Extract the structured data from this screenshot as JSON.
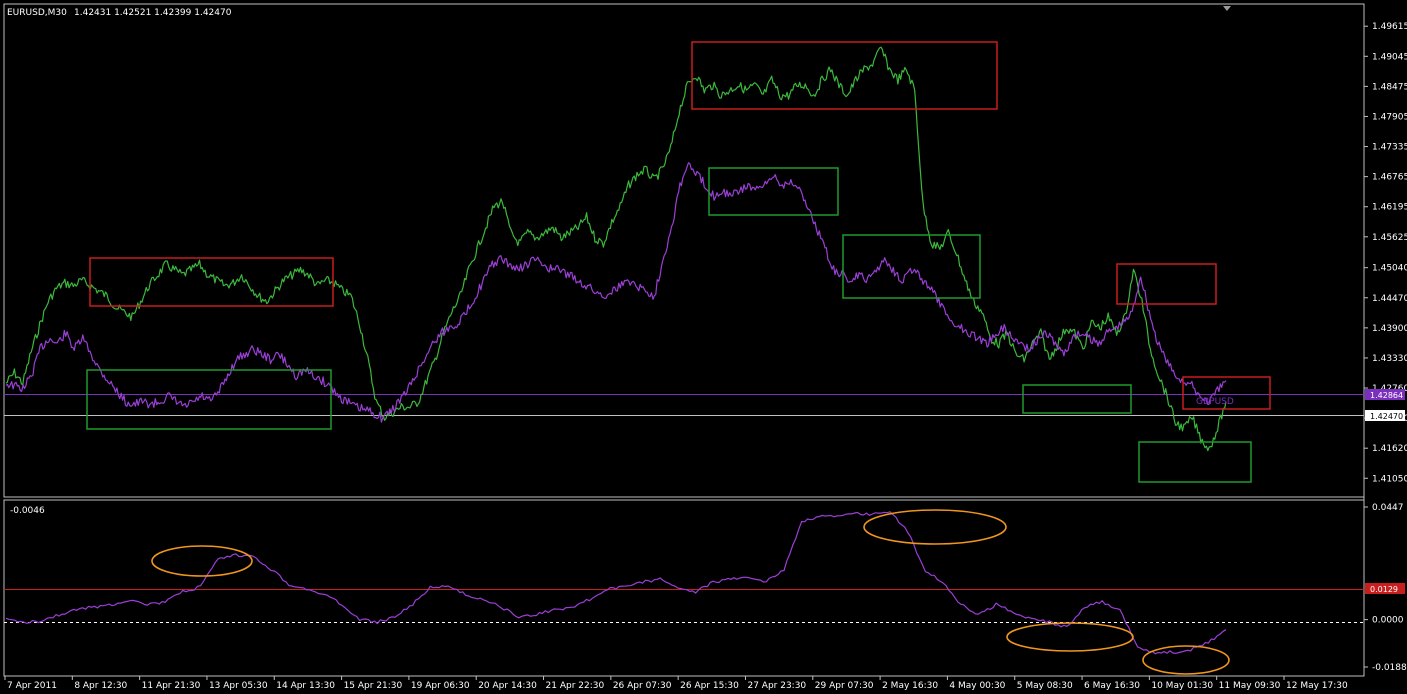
{
  "header": {
    "symbol_timeframe": "EURUSD,M30",
    "ohlc": "1.42431 1.42521 1.42399 1.42470"
  },
  "main_pane": {
    "price_ticks": [
      "1.49615",
      "1.49045",
      "1.48475",
      "1.47905",
      "1.47335",
      "1.46765",
      "1.46195",
      "1.45625",
      "1.45040",
      "1.44470",
      "1.43900",
      "1.43330",
      "1.42760",
      "1.42190",
      "1.41620",
      "1.41050"
    ],
    "price_range": [
      1.4079,
      1.4996
    ],
    "current_price": "1.42470",
    "overlay_price": "1.42864",
    "overlay_label": "GBPUSD",
    "colors": {
      "eurusd": "#3cb93c",
      "gbpusd": "#9b3fd6",
      "red_box": "#c81e1e",
      "green_box": "#1f9a2a",
      "hline": "#7b2fbf",
      "current_line": "#c0c0c0"
    }
  },
  "sub_pane": {
    "top_left_value": "-0.0046",
    "ticks": [
      "0.0447",
      "0.0000",
      "-0.0188"
    ],
    "level_tag": "0.0129",
    "range": [
      -0.0188,
      0.0447
    ],
    "colors": {
      "spread": "#9b3fd6",
      "level": "#c81e1e",
      "ellipse": "#f0961e"
    }
  },
  "time_axis": {
    "labels": [
      "7 Apr 2011",
      "8 Apr 12:30",
      "11 Apr 21:30",
      "13 Apr 05:30",
      "14 Apr 13:30",
      "15 Apr 21:30",
      "19 Apr 06:30",
      "20 Apr 14:30",
      "21 Apr 22:30",
      "26 Apr 07:30",
      "26 Apr 15:30",
      "27 Apr 23:30",
      "29 Apr 07:30",
      "2 May 16:30",
      "4 May 00:30",
      "5 May 08:30",
      "6 May 16:30",
      "10 May 01:30",
      "11 May 09:30",
      "12 May 17:30"
    ]
  },
  "chart_data": [
    {
      "type": "line",
      "title": "EURUSD,M30",
      "ylim": [
        1.4079,
        1.4996
      ],
      "series": [
        {
          "name": "EURUSD",
          "color": "#3cb93c",
          "values": [
            1.4285,
            1.4305,
            1.4285,
            1.4345,
            1.4395,
            1.444,
            1.4465,
            1.4475,
            1.447,
            1.448,
            1.447,
            1.446,
            1.445,
            1.443,
            1.442,
            1.441,
            1.444,
            1.447,
            1.449,
            1.451,
            1.45,
            1.449,
            1.45,
            1.451,
            1.449,
            1.448,
            1.447,
            1.4475,
            1.449,
            1.447,
            1.445,
            1.444,
            1.446,
            1.448,
            1.449,
            1.45,
            1.449,
            1.447,
            1.448,
            1.4475,
            1.446,
            1.445,
            1.44,
            1.433,
            1.425,
            1.422,
            1.423,
            1.424,
            1.424,
            1.425,
            1.429,
            1.433,
            1.438,
            1.442,
            1.445,
            1.45,
            1.454,
            1.458,
            1.462,
            1.463,
            1.457,
            1.455,
            1.457,
            1.456,
            1.457,
            1.458,
            1.456,
            1.457,
            1.458,
            1.46,
            1.456,
            1.455,
            1.459,
            1.462,
            1.466,
            1.468,
            1.469,
            1.467,
            1.469,
            1.473,
            1.48,
            1.485,
            1.487,
            1.484,
            1.485,
            1.483,
            1.484,
            1.485,
            1.484,
            1.485,
            1.483,
            1.486,
            1.483,
            1.483,
            1.485,
            1.485,
            1.483,
            1.486,
            1.488,
            1.485,
            1.483,
            1.486,
            1.488,
            1.489,
            1.492,
            1.488,
            1.486,
            1.488,
            1.484,
            1.462,
            1.455,
            1.454,
            1.457,
            1.453,
            1.448,
            1.444,
            1.442,
            1.437,
            1.436,
            1.438,
            1.434,
            1.433,
            1.436,
            1.438,
            1.433,
            1.436,
            1.439,
            1.438,
            1.435,
            1.44,
            1.439,
            1.441,
            1.438,
            1.441,
            1.45,
            1.444,
            1.435,
            1.43,
            1.426,
            1.421,
            1.42,
            1.422,
            1.418,
            1.416,
            1.42,
            1.425
          ]
        },
        {
          "name": "GBPUSD",
          "color": "#9b3fd6",
          "values": [
            1.4285,
            1.428,
            1.4275,
            1.43,
            1.435,
            1.437,
            1.436,
            1.438,
            1.435,
            1.437,
            1.434,
            1.431,
            1.429,
            1.427,
            1.425,
            1.4245,
            1.425,
            1.4245,
            1.425,
            1.426,
            1.425,
            1.424,
            1.425,
            1.426,
            1.425,
            1.427,
            1.43,
            1.433,
            1.434,
            1.435,
            1.434,
            1.433,
            1.434,
            1.432,
            1.43,
            1.431,
            1.43,
            1.429,
            1.428,
            1.426,
            1.425,
            1.424,
            1.4235,
            1.423,
            1.422,
            1.423,
            1.425,
            1.427,
            1.43,
            1.433,
            1.436,
            1.438,
            1.439,
            1.44,
            1.442,
            1.445,
            1.448,
            1.451,
            1.452,
            1.451,
            1.45,
            1.451,
            1.452,
            1.451,
            1.45,
            1.45,
            1.449,
            1.448,
            1.447,
            1.446,
            1.445,
            1.446,
            1.447,
            1.448,
            1.447,
            1.446,
            1.445,
            1.452,
            1.458,
            1.466,
            1.47,
            1.468,
            1.466,
            1.464,
            1.465,
            1.464,
            1.465,
            1.466,
            1.465,
            1.466,
            1.468,
            1.466,
            1.467,
            1.465,
            1.462,
            1.458,
            1.454,
            1.45,
            1.449,
            1.448,
            1.449,
            1.448,
            1.45,
            1.452,
            1.45,
            1.448,
            1.45,
            1.449,
            1.447,
            1.445,
            1.442,
            1.44,
            1.439,
            1.438,
            1.437,
            1.436,
            1.438,
            1.439,
            1.437,
            1.436,
            1.435,
            1.437,
            1.438,
            1.436,
            1.434,
            1.437,
            1.438,
            1.437,
            1.436,
            1.438,
            1.439,
            1.44,
            1.442,
            1.449,
            1.442,
            1.436,
            1.433,
            1.43,
            1.429,
            1.428,
            1.426,
            1.425,
            1.427,
            1.429
          ]
        }
      ]
    },
    {
      "type": "line",
      "ylim": [
        -0.0188,
        0.0447
      ],
      "series": [
        {
          "name": "",
          "color": "#9b3fd6",
          "values": [
            0.0,
            -0.001,
            -0.0005,
            0.002,
            0.004,
            0.005,
            0.006,
            0.008,
            0.006,
            0.007,
            0.011,
            0.013,
            0.024,
            0.0255,
            0.025,
            0.02,
            0.014,
            0.012,
            0.01,
            0.006,
            0.0,
            -0.001,
            0.001,
            0.006,
            0.013,
            0.013,
            0.01,
            0.008,
            0.005,
            0.001,
            0.002,
            0.004,
            0.005,
            0.008,
            0.012,
            0.013,
            0.015,
            0.016,
            0.013,
            0.011,
            0.015,
            0.016,
            0.017,
            0.015,
            0.02,
            0.039,
            0.041,
            0.041,
            0.042,
            0.042,
            0.043,
            0.035,
            0.019,
            0.015,
            0.006,
            0.002,
            0.006,
            0.003,
            0.0,
            -0.001,
            -0.003,
            0.005,
            0.007,
            0.004,
            -0.011,
            -0.013,
            -0.013,
            -0.012,
            -0.009,
            -0.004
          ]
        }
      ],
      "level": 0.0129
    }
  ]
}
